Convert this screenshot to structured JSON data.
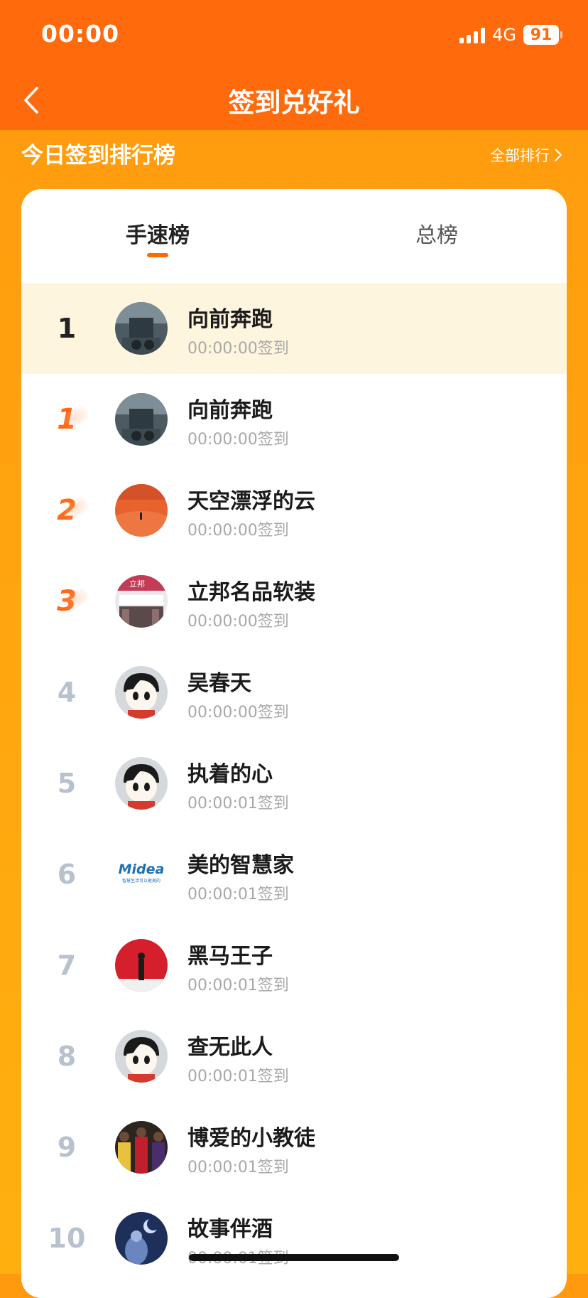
{
  "status_bar": {
    "time": "00:00",
    "network": "4G",
    "battery": "91"
  },
  "nav": {
    "title": "签到兑好礼"
  },
  "section": {
    "title": "今日签到排行榜",
    "all_rank_label": "全部排行"
  },
  "tabs": [
    {
      "label": "手速榜",
      "active": true
    },
    {
      "label": "总榜",
      "active": false
    }
  ],
  "my_entry": {
    "rank": "1",
    "name": "向前奔跑",
    "time": "00:00:00签到",
    "avatar": "street-scene-avatar"
  },
  "list": [
    {
      "rank": "1",
      "name": "向前奔跑",
      "time": "00:00:00签到",
      "avatar": "street-scene-avatar"
    },
    {
      "rank": "2",
      "name": "天空漂浮的云",
      "time": "00:00:00签到",
      "avatar": "desert-avatar"
    },
    {
      "rank": "3",
      "name": "立邦名品软装",
      "time": "00:00:00签到",
      "avatar": "storefront-avatar"
    },
    {
      "rank": "4",
      "name": "吴春天",
      "time": "00:00:00签到",
      "avatar": "default-cartoon-avatar"
    },
    {
      "rank": "5",
      "name": "执着的心",
      "time": "00:00:01签到",
      "avatar": "default-cartoon-avatar"
    },
    {
      "rank": "6",
      "name": "美的智慧家",
      "time": "00:00:01签到",
      "avatar": "midea-logo-avatar"
    },
    {
      "rank": "7",
      "name": "黑马王子",
      "time": "00:00:01签到",
      "avatar": "red-wall-avatar"
    },
    {
      "rank": "8",
      "name": "查无此人",
      "time": "00:00:01签到",
      "avatar": "default-cartoon-avatar"
    },
    {
      "rank": "9",
      "name": "博爱的小教徒",
      "time": "00:00:01签到",
      "avatar": "basketball-avatar"
    },
    {
      "rank": "10",
      "name": "故事伴酒",
      "time": "00:00:01签到",
      "avatar": "night-sky-avatar"
    }
  ],
  "logo_text": {
    "midea": "Midea",
    "midea_slogan": "智慧生活可以更美的",
    "libang": "立邦"
  },
  "colors": {
    "header": "#FF6B0C",
    "accent": "#FF6A00",
    "highlight_row": "#FEF5DF",
    "rank_grey": "#B8C2CF"
  }
}
